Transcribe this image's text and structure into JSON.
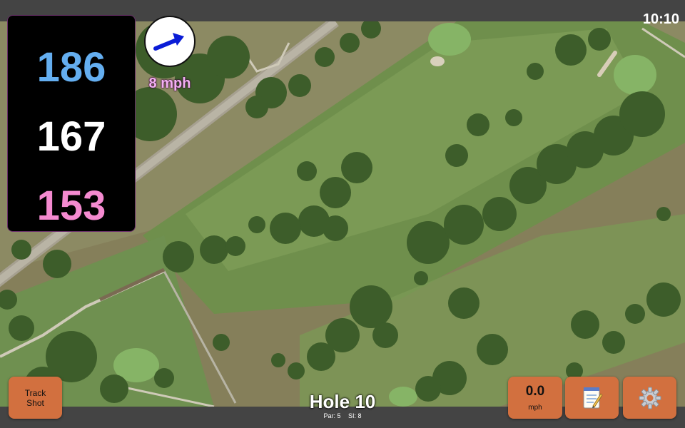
{
  "status": {
    "time": "10:10"
  },
  "distances": {
    "back": "186",
    "middle": "167",
    "front": "153"
  },
  "wind": {
    "speed_label": "8 mph",
    "direction_icon": "arrow-right-icon"
  },
  "track_button": {
    "line1": "Track",
    "line2": "Shot"
  },
  "hole": {
    "title": "Hole 10",
    "par_label": "Par: 5",
    "si_label": "SI: 8"
  },
  "speed_button": {
    "value": "0.0",
    "unit": "mph"
  },
  "icons": {
    "notes": "notepad-icon",
    "settings": "gear-icon"
  },
  "colors": {
    "back": "#64aef0",
    "middle": "#ffffff",
    "front": "#f48ad0",
    "button": "#d2703f",
    "wind_text": "#f2b0f2",
    "wind_arrow": "#0a1cd6"
  }
}
